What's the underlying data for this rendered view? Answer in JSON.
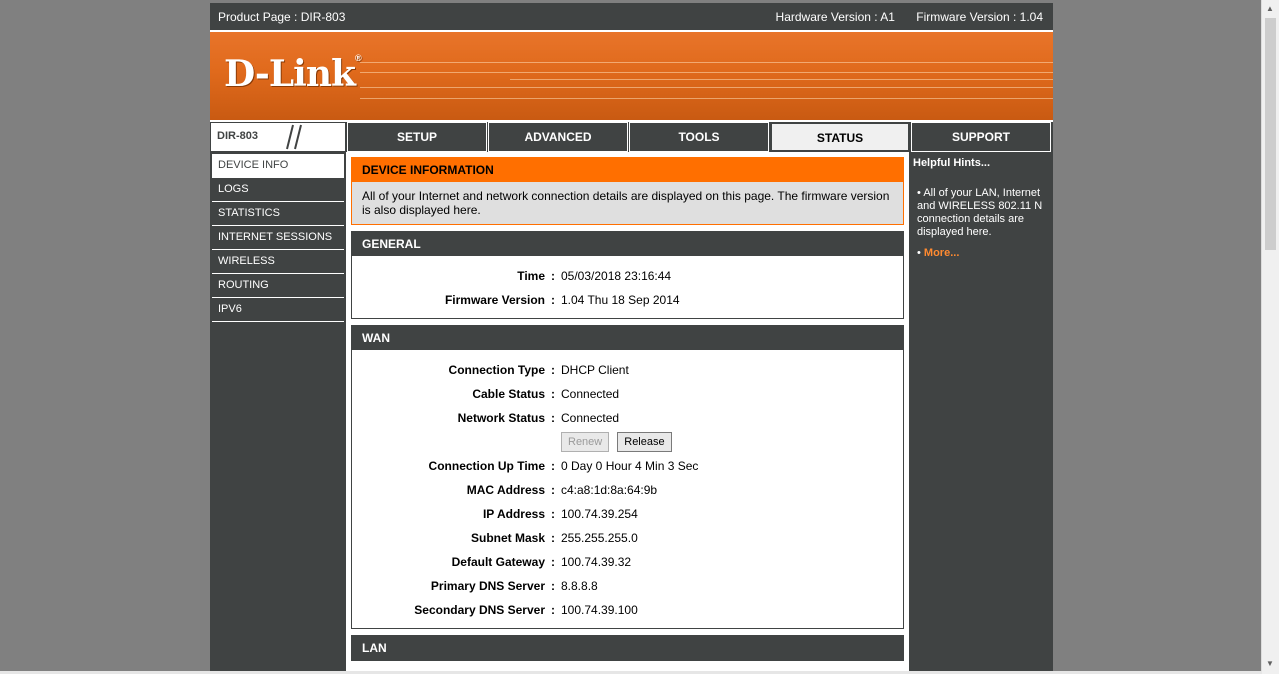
{
  "topbar": {
    "product": "Product Page : DIR-803",
    "hardware": "Hardware Version : A1",
    "firmware": "Firmware Version : 1.04"
  },
  "banner": {
    "logo": "D-Link",
    "logo_mark": "®"
  },
  "model": "DIR-803",
  "nav": [
    "SETUP",
    "ADVANCED",
    "TOOLS",
    "STATUS",
    "SUPPORT"
  ],
  "sidebar": [
    "DEVICE INFO",
    "LOGS",
    "STATISTICS",
    "INTERNET SESSIONS",
    "WIRELESS",
    "ROUTING",
    "IPV6"
  ],
  "device_info": {
    "title": "DEVICE INFORMATION",
    "text": "All of your Internet and network connection details are displayed on this page. The firmware version is also displayed here."
  },
  "general": {
    "title": "GENERAL",
    "rows": [
      {
        "label": "Time",
        "value": "05/03/2018 23:16:44"
      },
      {
        "label": "Firmware Version",
        "value": "1.04 Thu 18 Sep 2014"
      }
    ]
  },
  "wan": {
    "title": "WAN",
    "rows_top": [
      {
        "label": "Connection Type",
        "value": "DHCP Client"
      },
      {
        "label": "Cable Status",
        "value": "Connected"
      },
      {
        "label": "Network Status",
        "value": "Connected"
      }
    ],
    "renew": "Renew",
    "release": "Release",
    "rows_bottom": [
      {
        "label": "Connection Up Time",
        "value": "0 Day 0 Hour 4 Min 3 Sec"
      },
      {
        "label": "MAC Address",
        "value": "c4:a8:1d:8a:64:9b"
      },
      {
        "label": "IP Address",
        "value": "100.74.39.254"
      },
      {
        "label": "Subnet Mask",
        "value": "255.255.255.0"
      },
      {
        "label": "Default Gateway",
        "value": "100.74.39.32"
      },
      {
        "label": "Primary DNS Server",
        "value": "8.8.8.8"
      },
      {
        "label": "Secondary DNS Server",
        "value": "100.74.39.100"
      }
    ]
  },
  "lan": {
    "title": "LAN"
  },
  "hints": {
    "title": "Helpful Hints...",
    "text": "All of your LAN, Internet and WIRELESS 802.11 N connection details are displayed here.",
    "more": "More..."
  },
  "colors": {
    "accent": "#ff6f00",
    "dark": "#404343",
    "banner": "#e06a1c"
  }
}
